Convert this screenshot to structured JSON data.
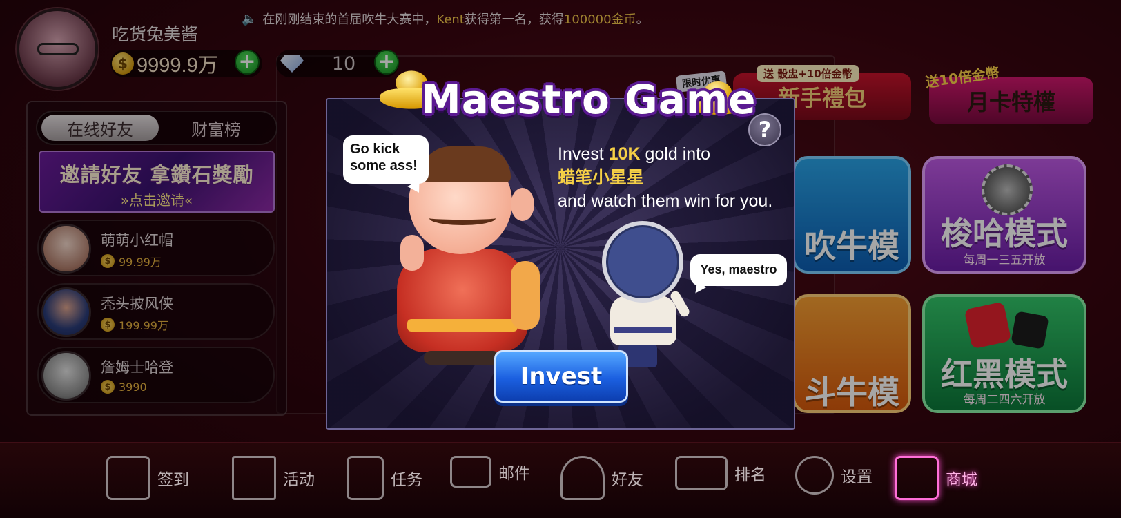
{
  "player": {
    "name": "吃货兔美酱",
    "gold": "9999.9万",
    "gems": "10",
    "coin_symbol": "$",
    "plus": "+"
  },
  "ticker": {
    "icon": "speaker-icon",
    "prefix": "在刚刚结束的首届吹牛大赛中，",
    "winner": "Kent",
    "middle": "获得第一名，获得",
    "amount": "100000金币",
    "suffix": "。"
  },
  "left_panel": {
    "tabs": [
      "在线好友",
      "财富榜"
    ],
    "invite_title": "邀請好友 拿鑽石獎勵",
    "invite_sub": "»点击邀请«",
    "friends": [
      {
        "name": "萌萌小红帽",
        "gold": "99.99万"
      },
      {
        "name": "秃头披风侠",
        "gold": "199.99万"
      },
      {
        "name": "詹姆士哈登",
        "gold": "3990"
      }
    ]
  },
  "promos": {
    "limited": "限时优惠",
    "newbie_tag": "送 骰盅+10倍金幣",
    "newbie": "新手禮包",
    "monthly_tag": "送10倍金幣",
    "monthly": "月卡特權"
  },
  "modes": [
    {
      "title": "吹牛模式",
      "sub": ""
    },
    {
      "title": "梭哈模式",
      "sub": "每周一三五开放"
    },
    {
      "title": "斗牛模式",
      "sub": ""
    },
    {
      "title": "红黑模式",
      "sub": "每周二四六开放"
    }
  ],
  "modal": {
    "title": "Maestro Game",
    "help": "?",
    "bubble_boss": "Go kick some ass!",
    "bubble_minion": "Yes, maestro",
    "desc_prefix": "Invest ",
    "desc_amount": "10K",
    "desc_mid": " gold into",
    "desc_target": "蜡笔小星星",
    "desc_suffix": "and watch them win for you.",
    "button": "Invest"
  },
  "bottom_nav": [
    {
      "label": "签到",
      "icon": "calendar-icon"
    },
    {
      "label": "活动",
      "icon": "document-icon"
    },
    {
      "label": "任务",
      "icon": "task-book-icon"
    },
    {
      "label": "邮件",
      "icon": "mail-icon"
    },
    {
      "label": "好友",
      "icon": "friends-icon"
    },
    {
      "label": "排名",
      "icon": "trophy-icon"
    },
    {
      "label": "设置",
      "icon": "gear-icon"
    },
    {
      "label": "商城",
      "icon": "cart-icon"
    }
  ]
}
